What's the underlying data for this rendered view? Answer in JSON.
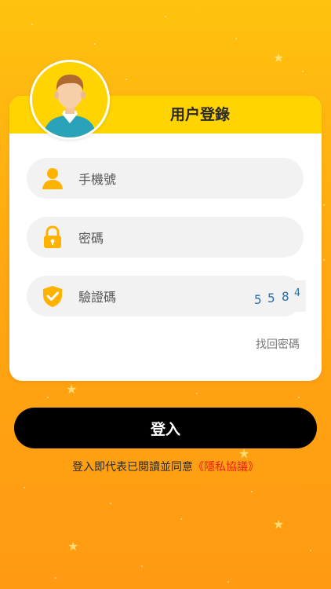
{
  "login_card": {
    "title": "用户登錄"
  },
  "fields": {
    "phone": {
      "placeholder": "手機號",
      "icon": "user-icon"
    },
    "password": {
      "placeholder": "密碼",
      "icon": "lock-icon"
    },
    "captcha": {
      "placeholder": "驗證碼",
      "icon": "shield-check-icon",
      "code": "5584"
    }
  },
  "forgot_password": "找回密碼",
  "login_button": "登入",
  "agreement": {
    "text": "登入即代表已閱讀並同意",
    "link": "《隱私協議》"
  },
  "colors": {
    "background_top": "#FFC20E",
    "background_bottom": "#FF9A12",
    "header": "#FFD400",
    "button": "#000000",
    "link": "#E8201A",
    "icon": "#FFB300"
  }
}
